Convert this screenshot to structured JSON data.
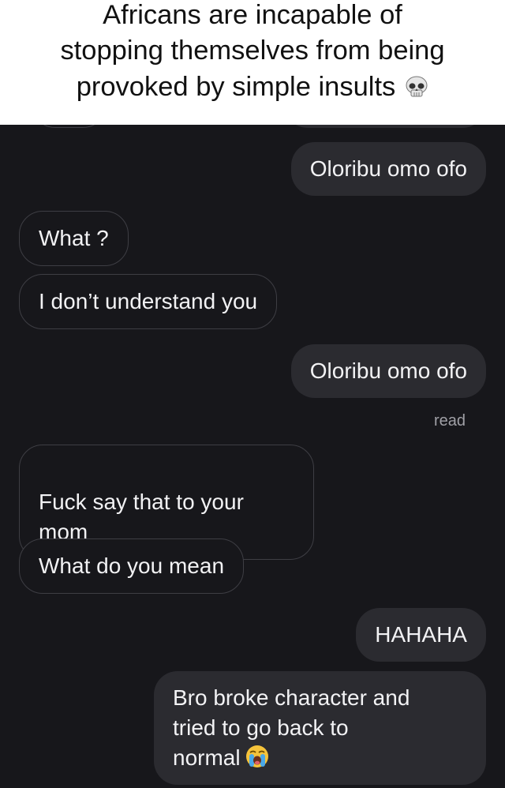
{
  "caption": {
    "lines": [
      "Africans are incapable of",
      "stopping themselves from being",
      "provoked by simple insults"
    ],
    "emoji": "skull-emoji"
  },
  "messages": [
    {
      "side": "outgoing",
      "text": "Oloribu omo ofo"
    },
    {
      "side": "incoming",
      "text": "What ?"
    },
    {
      "side": "incoming",
      "text": "I don’t understand you"
    },
    {
      "side": "outgoing",
      "text": "Oloribu omo ofo"
    },
    {
      "side": "incoming",
      "text": "Fuck say that to your\nmom"
    },
    {
      "side": "incoming",
      "text": "What do you mean"
    },
    {
      "side": "outgoing",
      "text": "HAHAHA"
    },
    {
      "side": "outgoing",
      "text": "Bro broke character and\ntried to go back to\nnormal",
      "emoji": "loudly-crying-face-emoji"
    }
  ],
  "status": {
    "read_label": "read"
  },
  "colors": {
    "background": "#17171b",
    "outgoing_bubble": "#2b2b30",
    "incoming_border": "#3e3e44",
    "text": "#f2f2f4",
    "read_text": "#a0a0a6"
  }
}
